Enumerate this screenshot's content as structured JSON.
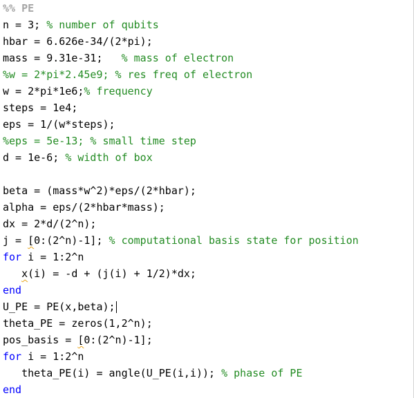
{
  "editor": {
    "lines": [
      [
        {
          "t": "section",
          "v": "%% PE"
        }
      ],
      [
        {
          "t": "code",
          "v": "n = 3; "
        },
        {
          "t": "comment",
          "v": "% number of qubits"
        }
      ],
      [
        {
          "t": "code",
          "v": "hbar = 6.626e-34/(2*pi);"
        }
      ],
      [
        {
          "t": "code",
          "v": "mass = 9.31e-31;   "
        },
        {
          "t": "comment",
          "v": "% mass of electron"
        }
      ],
      [
        {
          "t": "comment",
          "v": "%w = 2*pi*2.45e9; % res freq of electron"
        }
      ],
      [
        {
          "t": "code",
          "v": "w = 2*pi*1e6;"
        },
        {
          "t": "comment",
          "v": "% frequency"
        }
      ],
      [
        {
          "t": "code",
          "v": "steps = 1e4;"
        }
      ],
      [
        {
          "t": "code",
          "v": "eps = 1/(w*steps);"
        }
      ],
      [
        {
          "t": "comment",
          "v": "%eps = 5e-13; % small time step"
        }
      ],
      [
        {
          "t": "code",
          "v": "d = 1e-6; "
        },
        {
          "t": "comment",
          "v": "% width of box"
        }
      ],
      [],
      [
        {
          "t": "code",
          "v": "beta = (mass*w^2)*eps/(2*hbar);"
        }
      ],
      [
        {
          "t": "code",
          "v": "alpha = eps/(2*hbar*mass);"
        }
      ],
      [
        {
          "t": "code",
          "v": "dx = 2*d/(2^n);"
        }
      ],
      [
        {
          "t": "code",
          "v": "j = "
        },
        {
          "t": "code",
          "v": "[",
          "w": 1
        },
        {
          "t": "code",
          "v": "0:(2^n)-1]; "
        },
        {
          "t": "comment",
          "v": "% computational basis state for position"
        }
      ],
      [
        {
          "t": "keyword",
          "v": "for"
        },
        {
          "t": "code",
          "v": " i = 1:2^n"
        }
      ],
      [
        {
          "t": "code",
          "v": "   "
        },
        {
          "t": "code",
          "v": "x",
          "w": 1
        },
        {
          "t": "code",
          "v": "(i) = -d + (j(i) + 1/2)*dx;"
        }
      ],
      [
        {
          "t": "keyword",
          "v": "end"
        }
      ],
      [
        {
          "t": "code",
          "v": "U_PE = PE(x,beta);"
        },
        {
          "t": "caret",
          "v": ""
        }
      ],
      [
        {
          "t": "code",
          "v": "theta_PE = zeros(1,2^n);"
        }
      ],
      [
        {
          "t": "code",
          "v": "pos_basis = "
        },
        {
          "t": "code",
          "v": "[",
          "w": 1
        },
        {
          "t": "code",
          "v": "0:(2^n)-1];"
        }
      ],
      [
        {
          "t": "keyword",
          "v": "for"
        },
        {
          "t": "code",
          "v": " i = 1:2^n"
        }
      ],
      [
        {
          "t": "code",
          "v": "   theta_PE(i) = angle(U_PE(i,i)); "
        },
        {
          "t": "comment",
          "v": "% phase of PE"
        }
      ],
      [
        {
          "t": "keyword",
          "v": "end"
        }
      ]
    ]
  }
}
